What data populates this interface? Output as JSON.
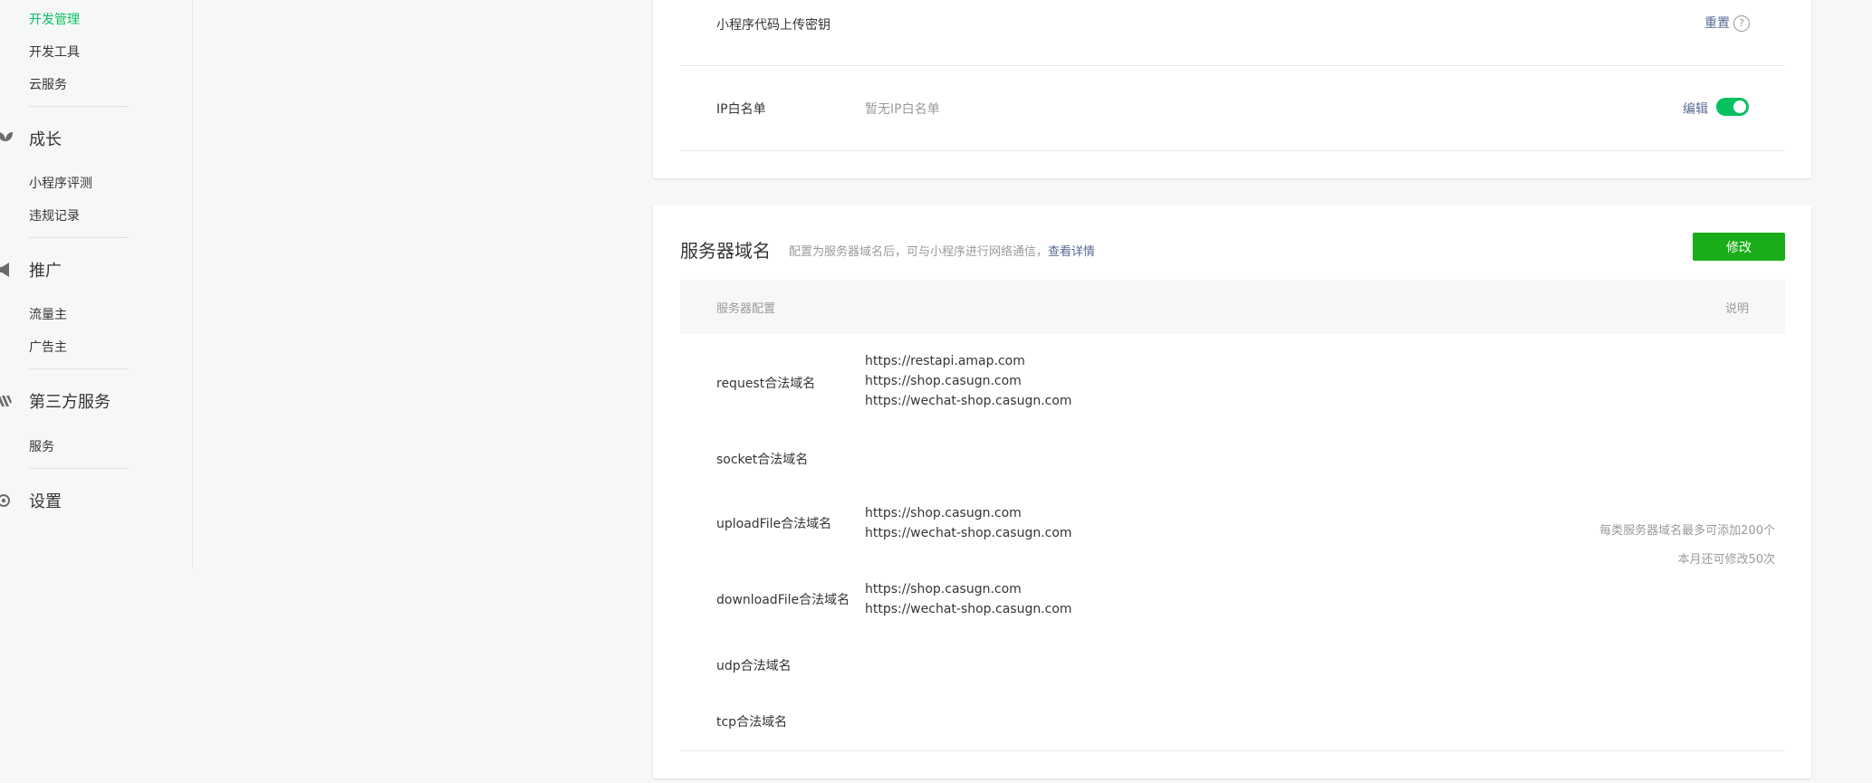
{
  "sidebar": {
    "dev": {
      "items": [
        {
          "label": "开发管理"
        },
        {
          "label": "开发工具"
        },
        {
          "label": "云服务"
        }
      ]
    },
    "growth": {
      "title": "成长",
      "items": [
        {
          "label": "小程序评测"
        },
        {
          "label": "违规记录"
        }
      ]
    },
    "promo": {
      "title": "推广",
      "items": [
        {
          "label": "流量主"
        },
        {
          "label": "广告主"
        }
      ]
    },
    "third": {
      "title": "第三方服务",
      "items": [
        {
          "label": "服务"
        }
      ]
    },
    "settings": {
      "title": "设置"
    }
  },
  "dev_card": {
    "upload_key": {
      "label": "小程序代码上传密钥",
      "action": "重置",
      "help": "?"
    },
    "ip_whitelist": {
      "label": "IP白名单",
      "value": "暂无IP白名单",
      "action": "编辑",
      "toggle_on": true
    }
  },
  "domain_card": {
    "title": "服务器域名",
    "desc": "配置为服务器域名后，可与小程序进行网络通信，",
    "desc_link": "查看详情",
    "modify_button": "修改",
    "table": {
      "col_config": "服务器配置",
      "col_note": "说明",
      "rows": [
        {
          "label": "request合法域名",
          "domains": [
            "https://restapi.amap.com",
            "https://shop.casugn.com",
            "https://wechat-shop.casugn.com"
          ]
        },
        {
          "label": "socket合法域名",
          "domains": []
        },
        {
          "label": "uploadFile合法域名",
          "domains": [
            "https://shop.casugn.com",
            "https://wechat-shop.casugn.com"
          ]
        },
        {
          "label": "downloadFile合法域名",
          "domains": [
            "https://shop.casugn.com",
            "https://wechat-shop.casugn.com"
          ]
        },
        {
          "label": "udp合法域名",
          "domains": []
        },
        {
          "label": "tcp合法域名",
          "domains": []
        }
      ],
      "note_lines": [
        "每类服务器域名最多可添加200个",
        "本月还可修改50次"
      ]
    }
  },
  "colors": {
    "accent": "#07c160",
    "button": "#1aad19",
    "link": "#576b95"
  }
}
